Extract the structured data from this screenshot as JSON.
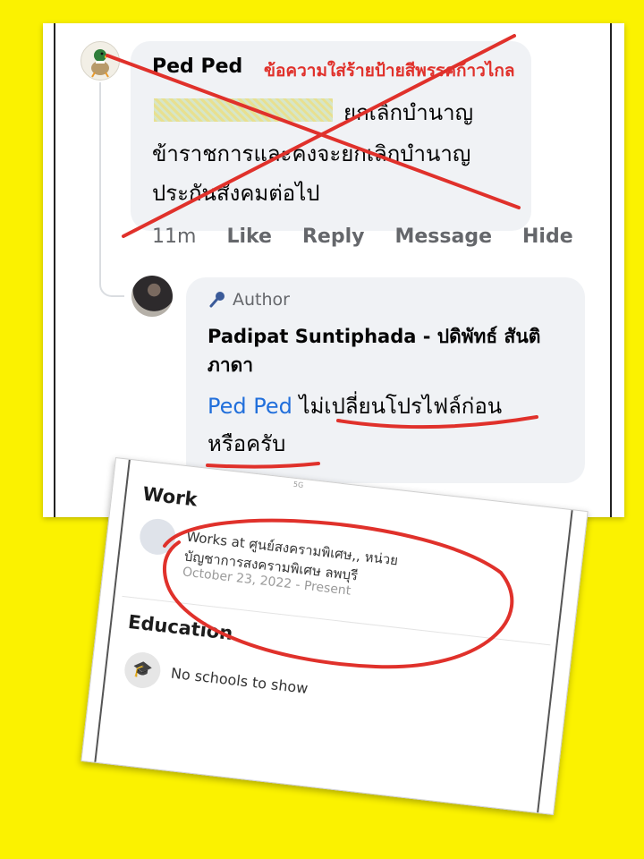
{
  "comment": {
    "author": "Ped Ped",
    "warning_label": "ข้อความใส่ร้ายป้ายสีพรรคก้าวไกล",
    "mention_blurred": "Sirigan...",
    "line1_rest": "ยกเลิกบำนาญ",
    "line2": "ข้าราชการและคงจะยกเลิกบำนาญ",
    "line3": "ประกันสังคมต่อไป",
    "actions": {
      "time": "11m",
      "like": "Like",
      "reply": "Reply",
      "message": "Message",
      "hide": "Hide"
    }
  },
  "reply": {
    "badge": "Author",
    "name_line1": "Padipat Suntiphada - ปดิพัทธ์ สันติ",
    "name_line2": "ภาดา",
    "mention": "Ped Ped",
    "text_line1_rest": " ไม่เปลี่ยนโปรไฟล์ก่อน",
    "text_line2": "หรือครับ"
  },
  "profile": {
    "status": "5G",
    "work_heading": "Work",
    "work_line1": "Works at ศูนย์สงครามพิเศษ,, หน่วย",
    "work_line2": "บัญชาการสงครามพิเศษ ลพบุรี",
    "work_date": "October 23, 2022 - Present",
    "education_heading": "Education",
    "education_text": "No schools to show"
  },
  "colors": {
    "background": "#fbf200",
    "annotation_red": "#e0312b",
    "mention_blue": "#216fdb",
    "meta_gray": "#65676b"
  },
  "icons": [
    "duck-avatar-icon",
    "author-avatar-icon",
    "microphone-icon",
    "briefcase-icon",
    "graduation-cap-icon"
  ]
}
